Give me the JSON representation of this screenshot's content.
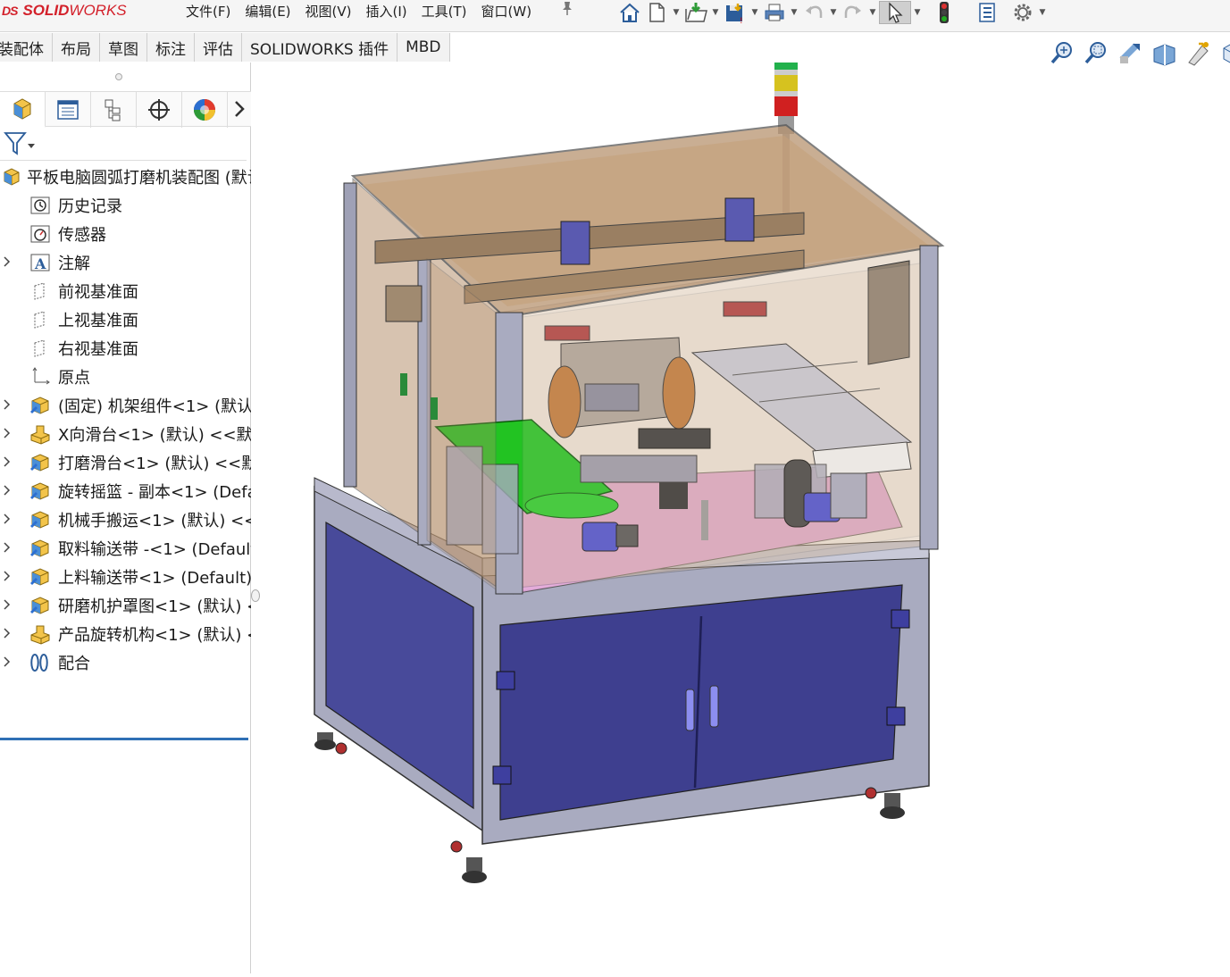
{
  "app": {
    "logo_prefix": "DS",
    "logo_solid": "SOLID",
    "logo_works": "WORKS"
  },
  "menu": [
    "文件(F)",
    "编辑(E)",
    "视图(V)",
    "插入(I)",
    "工具(T)",
    "窗口(W)"
  ],
  "toolbar": {
    "icons": [
      "home-icon",
      "new-document-icon",
      "open-icon",
      "save-icon",
      "print-icon",
      "undo-icon",
      "redo-icon",
      "select-pointer-icon",
      "traffic-light-icon",
      "file-properties-icon",
      "options-gear-icon"
    ]
  },
  "tabs": [
    "装配体",
    "布局",
    "草图",
    "标注",
    "评估",
    "SOLIDWORKS 插件",
    "MBD"
  ],
  "panel_tabs": {
    "icons": [
      "featuremanager-tree-icon",
      "propertymanager-icon",
      "configurationmanager-icon",
      "dimxpert-icon",
      "display-manager-icon",
      "more-arrow-icon"
    ]
  },
  "tree": {
    "root": "平板电脑圆弧打磨机装配图 (默认",
    "items": [
      {
        "label": "历史记录",
        "icon": "history-icon",
        "expandable": false
      },
      {
        "label": "传感器",
        "icon": "sensor-icon",
        "expandable": false
      },
      {
        "label": "注解",
        "icon": "annotation-icon",
        "expandable": true
      },
      {
        "label": "前视基准面",
        "icon": "plane-icon",
        "expandable": false
      },
      {
        "label": "上视基准面",
        "icon": "plane-icon",
        "expandable": false
      },
      {
        "label": "右视基准面",
        "icon": "plane-icon",
        "expandable": false
      },
      {
        "label": "原点",
        "icon": "origin-icon",
        "expandable": false
      },
      {
        "label": "(固定) 机架组件<1> (默认)",
        "icon": "subassembly-icon",
        "expandable": true
      },
      {
        "label": "X向滑台<1> (默认) <<默认",
        "icon": "part-icon",
        "expandable": true
      },
      {
        "label": "打磨滑台<1> (默认) <<默",
        "icon": "subassembly-icon",
        "expandable": true
      },
      {
        "label": "旋转摇篮 - 副本<1> (Defa",
        "icon": "subassembly-icon",
        "expandable": true
      },
      {
        "label": "机械手搬运<1> (默认) <<",
        "icon": "subassembly-icon",
        "expandable": true
      },
      {
        "label": "取料输送带 -<1> (Default",
        "icon": "subassembly-icon",
        "expandable": true
      },
      {
        "label": "上料输送带<1> (Default)",
        "icon": "subassembly-icon",
        "expandable": true
      },
      {
        "label": "研磨机护罩图<1> (默认) <",
        "icon": "subassembly-icon",
        "expandable": true
      },
      {
        "label": "产品旋转机构<1> (默认) <",
        "icon": "part-icon",
        "expandable": true
      },
      {
        "label": "配合",
        "icon": "mates-icon",
        "expandable": true
      }
    ]
  },
  "view_tools": {
    "icons": [
      "zoom-to-fit-icon",
      "zoom-area-icon",
      "previous-view-icon",
      "section-view-icon",
      "dynamic-annotation-icon",
      "view-orientation-icon"
    ]
  },
  "colors": {
    "cabinet_blue": "#3e3f8f",
    "frame_gray": "#a9abc0",
    "glass_brown": "#b79370",
    "belt_green": "#22c322",
    "plate_pink": "#e8a8e6",
    "tower_green": "#22b14c",
    "tower_yellow": "#d6c21f",
    "tower_red": "#d02020"
  }
}
